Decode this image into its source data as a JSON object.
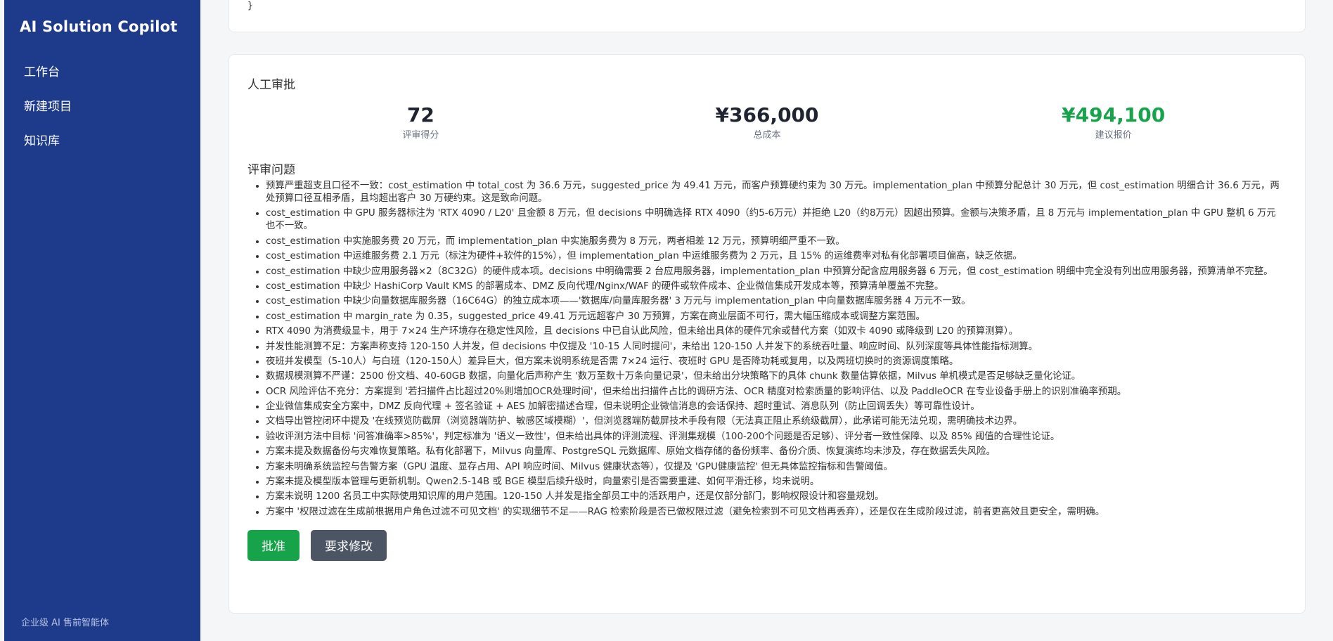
{
  "app": {
    "brand": "AI Solution Copilot",
    "nav": [
      {
        "label": "工作台"
      },
      {
        "label": "新建项目"
      },
      {
        "label": "知识库"
      }
    ],
    "footer": "企业级 AI 售前智能体"
  },
  "code_tail": "}",
  "review": {
    "title": "人工审批",
    "stats": {
      "score": {
        "value": "72",
        "label": "评审得分"
      },
      "cost": {
        "value": "¥366,000",
        "label": "总成本"
      },
      "price": {
        "value": "¥494,100",
        "label": "建议报价"
      }
    },
    "issues_title": "评审问题",
    "issues": [
      "预算严重超支且口径不一致：cost_estimation 中 total_cost 为 36.6 万元，suggested_price 为 49.41 万元，而客户预算硬约束为 30 万元。implementation_plan 中预算分配总计 30 万元，但 cost_estimation 明细合计 36.6 万元，两处预算口径互相矛盾，且均超出客户 30 万硬约束。这是致命问题。",
      "cost_estimation 中 GPU 服务器标注为 'RTX 4090 / L20' 且金额 8 万元，但 decisions 中明确选择 RTX 4090（约5-6万元）并拒绝 L20（约8万元）因超出预算。金额与决策矛盾，且 8 万元与 implementation_plan 中 GPU 整机 6 万元也不一致。",
      "cost_estimation 中实施服务费 20 万元，而 implementation_plan 中实施服务费为 8 万元，两者相差 12 万元，预算明细严重不一致。",
      "cost_estimation 中运维服务费 2.1 万元（标注为硬件+软件的15%），但 implementation_plan 中运维服务费为 2 万元，且 15% 的运维费率对私有化部署项目偏高，缺乏依据。",
      "cost_estimation 中缺少应用服务器×2（8C32G）的硬件成本项。decisions 中明确需要 2 台应用服务器，implementation_plan 中预算分配含应用服务器 6 万元，但 cost_estimation 明细中完全没有列出应用服务器，预算清单不完整。",
      "cost_estimation 中缺少 HashiCorp Vault KMS 的部署成本、DMZ 反向代理/Nginx/WAF 的硬件或软件成本、企业微信集成开发成本等，预算清单覆盖不完整。",
      "cost_estimation 中缺少向量数据库服务器（16C64G）的独立成本项——'数据库/向量库服务器' 3 万元与 implementation_plan 中向量数据库服务器 4 万元不一致。",
      "cost_estimation 中 margin_rate 为 0.35，suggested_price 49.41 万元远超客户 30 万预算，方案在商业层面不可行，需大幅压缩成本或调整方案范围。",
      "RTX 4090 为消费级显卡，用于 7×24 生产环境存在稳定性风险，且 decisions 中已自认此风险，但未给出具体的硬件冗余或替代方案（如双卡 4090 或降级到 L20 的预算测算）。",
      "并发性能测算不足：方案声称支持 120-150 人并发，但 decisions 中仅提及 '10-15 人同时提问'，未给出 120-150 人并发下的系统吞吐量、响应时间、队列深度等具体性能指标测算。",
      "夜班并发模型（5-10人）与白班（120-150人）差异巨大，但方案未说明系统是否需 7×24 运行、夜班时 GPU 是否降功耗或复用，以及两班切换时的资源调度策略。",
      "数据规模测算不严谨：2500 份文档、40-60GB 数据，向量化后声称产生 '数万至数十万条向量记录'，但未给出分块策略下的具体 chunk 数量估算依据，Milvus 单机模式是否足够缺乏量化论证。",
      "OCR 风险评估不充分：方案提到 '若扫描件占比超过20%则增加OCR处理时间'，但未给出扫描件占比的调研方法、OCR 精度对检索质量的影响评估、以及 PaddleOCR 在专业设备手册上的识别准确率预期。",
      "企业微信集成安全方案中，DMZ 反向代理 + 签名验证 + AES 加解密描述合理，但未说明企业微信消息的会话保持、超时重试、消息队列（防止回调丢失）等可靠性设计。",
      "文档导出管控闭环中提及 '在线预览防截屏（浏览器端防护、敏感区域模糊）'，但浏览器端防截屏技术手段有限（无法真正阻止系统级截屏），此承诺可能无法兑现，需明确技术边界。",
      "验收评测方法中目标 '问答准确率>85%'，判定标准为 '语义一致性'，但未给出具体的评测流程、评测集规模（100-200个问题是否足够）、评分者一致性保障、以及 85% 阈值的合理性论证。",
      "方案未提及数据备份与灾难恢复策略。私有化部署下，Milvus 向量库、PostgreSQL 元数据库、原始文档存储的备份频率、备份介质、恢复演练均未涉及，存在数据丢失风险。",
      "方案未明确系统监控与告警方案（GPU 温度、显存占用、API 响应时间、Milvus 健康状态等），仅提及 'GPU健康监控' 但无具体监控指标和告警阈值。",
      "方案未提及模型版本管理与更新机制。Qwen2.5-14B 或 BGE 模型后续升级时，向量索引是否需要重建、如何平滑迁移，均未说明。",
      "方案未说明 1200 名员工中实际使用知识库的用户范围。120-150 人并发是指全部员工中的活跃用户，还是仅部分部门，影响权限设计和容量规划。",
      "方案中 '权限过滤在生成前根据用户角色过滤不可见文档' 的实现细节不足——RAG 检索阶段是否已做权限过滤（避免检索到不可见文档再丢弃），还是仅在生成阶段过滤，前者更高效且更安全，需明确。"
    ],
    "approve_label": "批准",
    "revise_label": "要求修改"
  }
}
